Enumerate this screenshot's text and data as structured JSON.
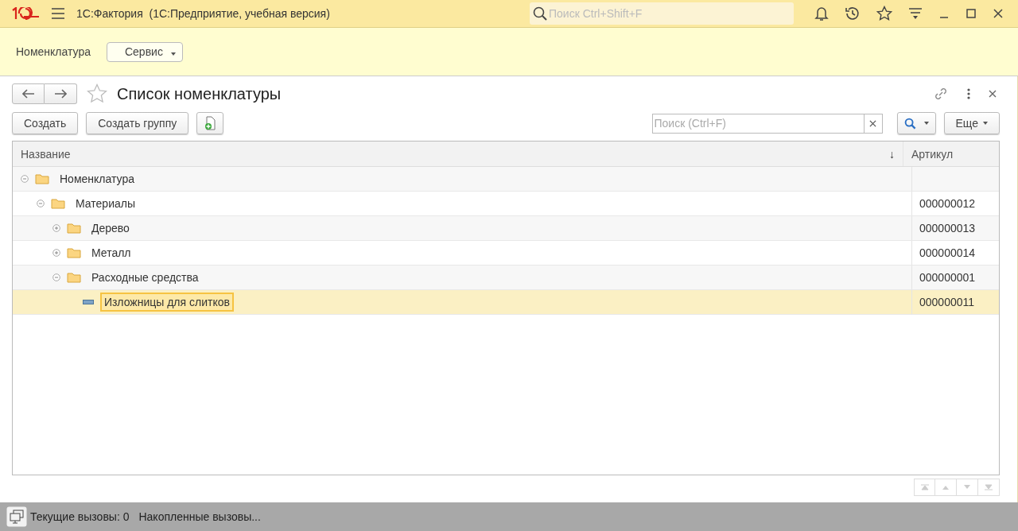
{
  "window": {
    "title": "1С:Фактория  (1С:Предприятие, учебная версия)",
    "search": {
      "placeholder": "Поиск Ctrl+Shift+F"
    }
  },
  "sections": [
    {
      "label": "Номенклатура",
      "kind": "link"
    },
    {
      "label": "Сервис",
      "kind": "menu"
    }
  ],
  "form": {
    "title": "Список номенклатуры",
    "favorite": false,
    "buttons": [
      "Создать",
      "Создать группу"
    ],
    "search": {
      "placeholder": "Поиск (Ctrl+F)"
    },
    "more": "Еще",
    "table": {
      "columns": [
        {
          "label": "Название",
          "sort": "↓"
        },
        {
          "label": "Артикул"
        }
      ],
      "rows": [
        {
          "name": "Номенклатура",
          "kind": "folder",
          "expanded": true,
          "selected": false,
          "article": "",
          "children": [
            {
              "name": "Материалы",
              "kind": "folder",
              "expanded": true,
              "selected": false,
              "article": "000000012",
              "children": [
                {
                  "name": "Дерево",
                  "kind": "folder",
                  "expanded": false,
                  "selected": false,
                  "article": "000000013"
                },
                {
                  "name": "Металл",
                  "kind": "folder",
                  "expanded": false,
                  "selected": false,
                  "article": "000000014"
                },
                {
                  "name": "Расходные средства",
                  "kind": "folder",
                  "expanded": true,
                  "selected": false,
                  "article": "000000001",
                  "children": [
                    {
                      "name": "Изложницы для слитков",
                      "kind": "item",
                      "selected": true,
                      "article": "000000011"
                    }
                  ]
                }
              ]
            }
          ]
        }
      ]
    }
  },
  "status_bar": {
    "current_calls": "Текущие вызовы: 0",
    "accumulated_calls": "Накопленные вызовы..."
  }
}
